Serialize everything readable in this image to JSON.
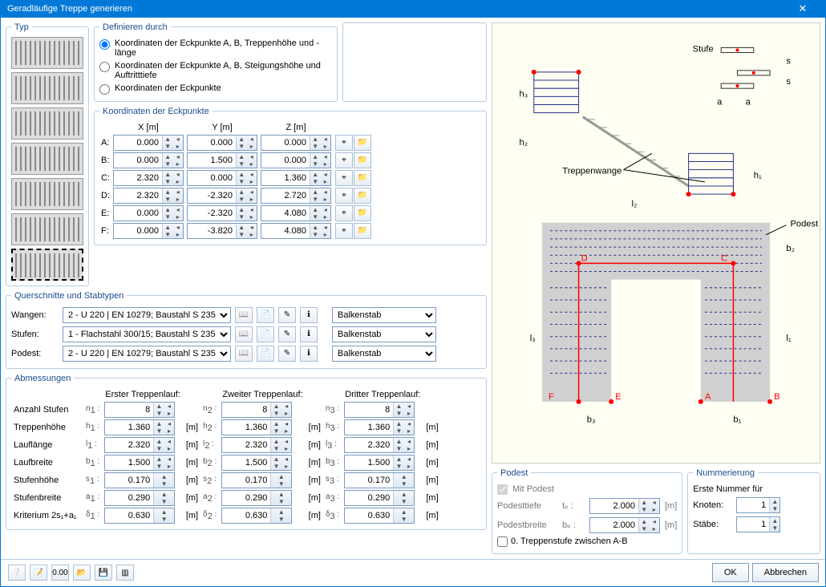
{
  "title": "Geradläufige Treppe generieren",
  "groups": {
    "typ": "Typ",
    "def": "Definieren durch",
    "coord": "Koordinaten der Eckpunkte",
    "qs": "Querschnitte und Stabtypen",
    "abm": "Abmessungen",
    "podest": "Podest",
    "num": "Nummerierung"
  },
  "def_opts": {
    "o1": "Koordinaten der Eckpunkte A, B, Treppenhöhe und -länge",
    "o2": "Koordinaten der Eckpunkte A, B, Steigungshöhe und Auftritttiefe",
    "o3": "Koordinaten der Eckpunkte"
  },
  "coord": {
    "hx": "X  [m]",
    "hy": "Y  [m]",
    "hz": "Z  [m]",
    "rows": [
      {
        "l": "A:",
        "x": "0.000",
        "y": "0.000",
        "z": "0.000"
      },
      {
        "l": "B:",
        "x": "0.000",
        "y": "1.500",
        "z": "0.000"
      },
      {
        "l": "C:",
        "x": "2.320",
        "y": "0.000",
        "z": "1.360"
      },
      {
        "l": "D:",
        "x": "2.320",
        "y": "-2.320",
        "z": "2.720"
      },
      {
        "l": "E:",
        "x": "0.000",
        "y": "-2.320",
        "z": "4.080"
      },
      {
        "l": "F:",
        "x": "0.000",
        "y": "-3.820",
        "z": "4.080"
      }
    ]
  },
  "qs": {
    "wangen_l": "Wangen:",
    "stufen_l": "Stufen:",
    "podest_l": "Podest:",
    "wangen_v": "2 - U 220 | EN 10279; Baustahl S 235",
    "stufen_v": "1 - Flachstahl 300/15; Baustahl S 235",
    "podest_v": "2 - U 220 | EN 10279; Baustahl S 235",
    "balken": "Balkenstab"
  },
  "abm": {
    "h1": "Erster Treppenlauf:",
    "h2": "Zweiter Treppenlauf:",
    "h3": "Dritter Treppenlauf:",
    "rows": [
      {
        "lbl": "Anzahl Stufen",
        "s": "n",
        "v": [
          "8",
          "8",
          "8"
        ],
        "u": ""
      },
      {
        "lbl": "Treppenhöhe",
        "s": "h",
        "v": [
          "1.360",
          "1.360",
          "1.360"
        ],
        "u": "[m]"
      },
      {
        "lbl": "Lauflänge",
        "s": "l",
        "v": [
          "2.320",
          "2.320",
          "2.320"
        ],
        "u": "[m]"
      },
      {
        "lbl": "Laufbreite",
        "s": "b",
        "v": [
          "1.500",
          "1.500",
          "1.500"
        ],
        "u": "[m]"
      },
      {
        "lbl": "Stufenhöhe",
        "s": "s",
        "v": [
          "0.170",
          "0.170",
          "0.170"
        ],
        "u": "[m]"
      },
      {
        "lbl": "Stufenbreite",
        "s": "a",
        "v": [
          "0.290",
          "0.290",
          "0.290"
        ],
        "u": "[m]"
      },
      {
        "lbl": "Kriterium 2s₁+a₁",
        "s": "δ",
        "v": [
          "0.630",
          "0.630",
          "0.630"
        ],
        "u": "[m]"
      }
    ]
  },
  "podest": {
    "mit": "Mit Podest",
    "tiefe_l": "Podesttiefe",
    "tiefe_s": "tₚ :",
    "tiefe_v": "2.000",
    "breite_l": "Podestbreite",
    "breite_s": "bₚ :",
    "breite_v": "2.000",
    "unit": "[m]",
    "zerostep": "0. Treppenstufe zwischen A-B"
  },
  "num": {
    "erste": "Erste Nummer für",
    "knoten": "Knoten:",
    "stabe": "Stäbe:",
    "kv": "1",
    "sv": "1"
  },
  "preview_labels": {
    "stufe": "Stufe",
    "wange": "Treppenwange",
    "podest": "Podest"
  },
  "buttons": {
    "ok": "OK",
    "cancel": "Abbrechen"
  }
}
